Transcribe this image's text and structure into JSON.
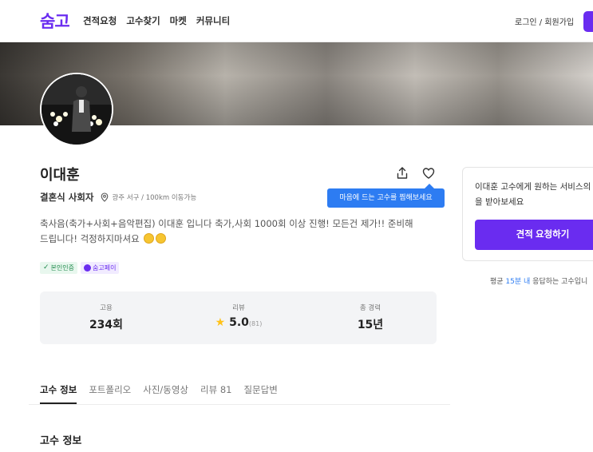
{
  "header": {
    "logo": "숨고",
    "nav": [
      "견적요청",
      "고수찾기",
      "마켓",
      "커뮤니티"
    ],
    "login": "로그인 / 회원가입"
  },
  "profile": {
    "name": "이대훈",
    "category": "결혼식 사회자",
    "location": "광주 서구 / 100km 이동가능",
    "intro": "축사음(축가+사회+음악편집) 이대훈 입니다 축가,사회 1000회 이상 진행! 모든건 제가!! 준비해 드립니다! 걱정하지마셔요",
    "tooltip": "마음에 드는 고수를 찜해보세요",
    "badges": [
      "본인인증",
      "숨고페이"
    ]
  },
  "stats": [
    {
      "label": "고용",
      "value": "234회"
    },
    {
      "label": "리뷰",
      "value": "5.0",
      "count": "(81)"
    },
    {
      "label": "총 경력",
      "value": "15년"
    }
  ],
  "tabs": [
    "고수 정보",
    "포트폴리오",
    "사진/동영상",
    "리뷰 81",
    "질문답변"
  ],
  "section_title": "고수 정보",
  "request_card": {
    "line1": "이대훈 고수에게 원하는 서비스의",
    "line2": "을 받아보세요",
    "button": "견적 요청하기"
  },
  "response": {
    "prefix": "평균 ",
    "highlight": "15분 내",
    "suffix": " 응답하는 고수입니"
  },
  "colors": {
    "brand": "#6a2cf0",
    "tooltip": "#2d7cf2",
    "star": "#ffc21a"
  }
}
